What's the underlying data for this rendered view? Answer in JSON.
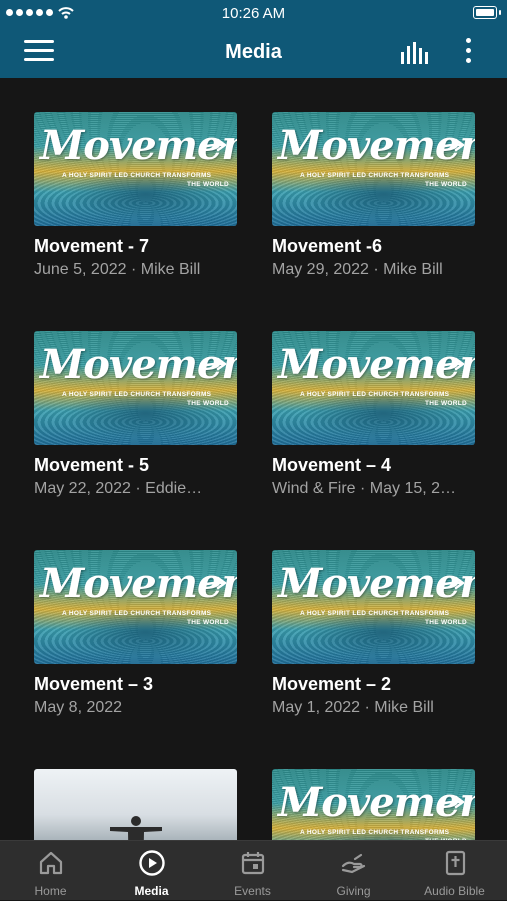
{
  "status_bar": {
    "time": "10:26 AM"
  },
  "nav": {
    "title": "Media"
  },
  "thumbnail_text": {
    "logo": "Movement",
    "tag_line1": "A HOLY SPIRIT LED CHURCH TRANSFORMS",
    "tag_line2": "THE WORLD"
  },
  "cards": [
    {
      "title": "Movement - 7",
      "subtitle": "June 5, 2022 · Mike Bill",
      "thumb": "movement"
    },
    {
      "title": "Movement -6",
      "subtitle": "May 29, 2022 · Mike Bill",
      "thumb": "movement"
    },
    {
      "title": "Movement - 5",
      "subtitle": "May 22, 2022 · Eddie…",
      "thumb": "movement"
    },
    {
      "title": "Movement – 4",
      "subtitle": "Wind & Fire · May 15, 2…",
      "thumb": "movement"
    },
    {
      "title": "Movement – 3",
      "subtitle": "May 8, 2022",
      "thumb": "movement"
    },
    {
      "title": "Movement – 2",
      "subtitle": "May 1, 2022 · Mike Bill",
      "thumb": "movement"
    },
    {
      "title": "",
      "subtitle": "",
      "thumb": "photo-person-arms-outstretched"
    },
    {
      "title": "",
      "subtitle": "",
      "thumb": "movement"
    }
  ],
  "tabs": [
    {
      "label": "Home",
      "icon": "home-icon",
      "active": false
    },
    {
      "label": "Media",
      "icon": "play-circle-icon",
      "active": true
    },
    {
      "label": "Events",
      "icon": "calendar-icon",
      "active": false
    },
    {
      "label": "Giving",
      "icon": "giving-hand-icon",
      "active": false
    },
    {
      "label": "Audio Bible",
      "icon": "bible-icon",
      "active": false
    }
  ],
  "colors": {
    "header": "#0f5877",
    "background": "#161616",
    "tab_bar": "#2e2e2e",
    "subtitle_text": "#a3a3a3",
    "inactive_tab": "#9a9a9a"
  }
}
